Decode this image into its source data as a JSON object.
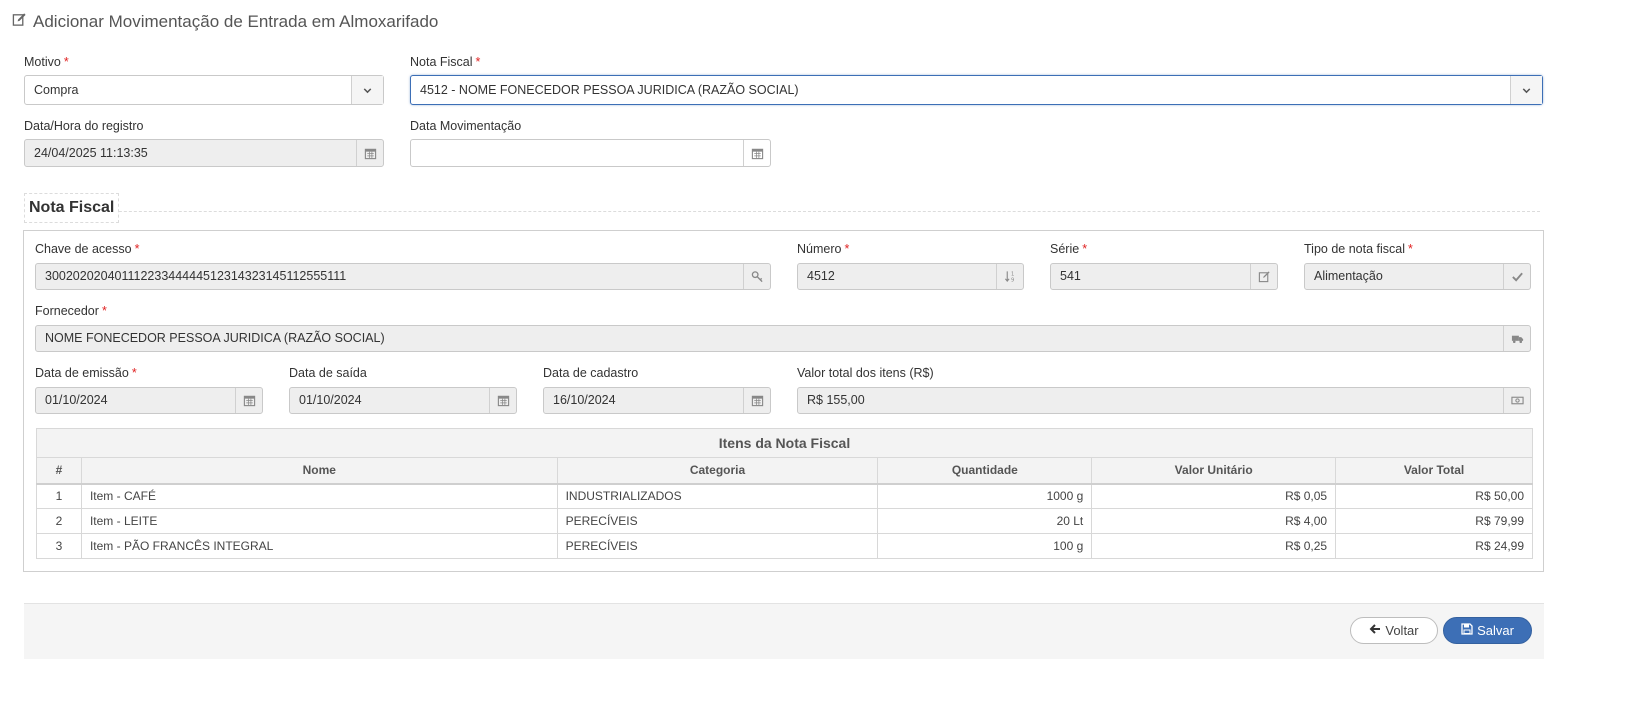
{
  "page": {
    "title": "Adicionar Movimentação de Entrada em Almoxarifado"
  },
  "colors": {
    "primary": "#3d6fb6",
    "required": "#e02222",
    "readonly_bg": "#eeeeee"
  },
  "form": {
    "motivo": {
      "label": "Motivo",
      "value": "Compra"
    },
    "nota_fiscal": {
      "label": "Nota Fiscal",
      "value": "4512 - NOME FONECEDOR PESSOA JURIDICA (RAZÃO SOCIAL)"
    },
    "data_hora_registro": {
      "label": "Data/Hora do registro",
      "value": "24/04/2025 11:13:35"
    },
    "data_movimentacao": {
      "label": "Data Movimentação",
      "value": ""
    }
  },
  "nota": {
    "section_title": "Nota Fiscal",
    "chave_acesso": {
      "label": "Chave de acesso",
      "value": "30020202040111223344444512314323145112555111"
    },
    "numero": {
      "label": "Número",
      "value": "4512"
    },
    "serie": {
      "label": "Série",
      "value": "541"
    },
    "tipo": {
      "label": "Tipo de nota fiscal",
      "value": "Alimentação"
    },
    "fornecedor": {
      "label": "Fornecedor",
      "value": "NOME FONECEDOR PESSOA JURIDICA (RAZÃO SOCIAL)"
    },
    "data_emissao": {
      "label": "Data de emissão",
      "value": "01/10/2024"
    },
    "data_saida": {
      "label": "Data de saída",
      "value": "01/10/2024"
    },
    "data_cadastro": {
      "label": "Data de cadastro",
      "value": "16/10/2024"
    },
    "valor_total": {
      "label": "Valor total dos itens (R$)",
      "value": "R$ 155,00"
    }
  },
  "items_table": {
    "caption": "Itens da Nota Fiscal",
    "columns": [
      "#",
      "Nome",
      "Categoria",
      "Quantidade",
      "Valor Unitário",
      "Valor Total"
    ],
    "rows": [
      [
        "1",
        "Item - CAFÉ",
        "INDUSTRIALIZADOS",
        "1000 g",
        "R$ 0,05",
        "R$ 50,00"
      ],
      [
        "2",
        "Item - LEITE",
        "PERECÍVEIS",
        "20 Lt",
        "R$ 4,00",
        "R$ 79,99"
      ],
      [
        "3",
        "Item - PÃO FRANCÊS INTEGRAL",
        "PERECÍVEIS",
        "100 g",
        "R$ 0,25",
        "R$ 24,99"
      ]
    ]
  },
  "actions": {
    "back": "Voltar",
    "save": "Salvar"
  },
  "icons": {
    "title": "edit-icon",
    "select": "chevron-down-icon",
    "date": "calendar-icon",
    "key": "key-icon",
    "number": "sort-numeric-icon",
    "serie": "edit-icon",
    "tipo": "check-icon",
    "fornecedor": "truck-icon",
    "valor": "money-icon",
    "back": "arrow-left-icon",
    "save": "floppy-disk-icon"
  }
}
